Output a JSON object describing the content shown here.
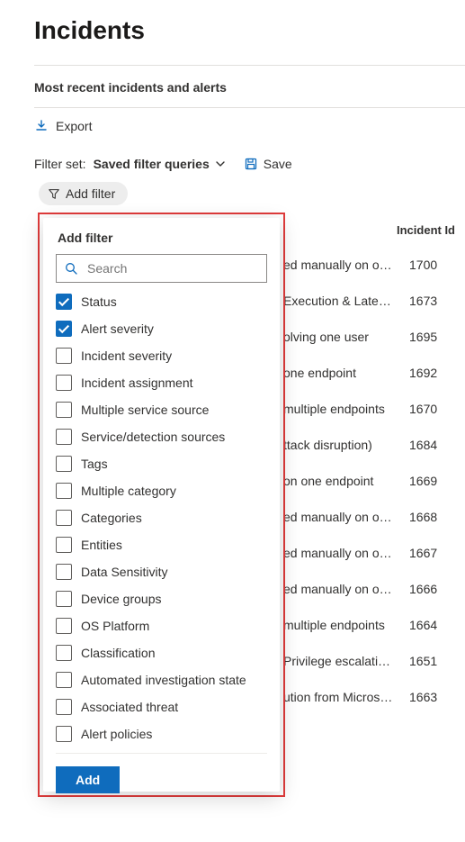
{
  "header": {
    "title": "Incidents",
    "subtitle": "Most recent incidents and alerts"
  },
  "toolbar": {
    "export_label": "Export"
  },
  "filterset": {
    "label": "Filter set:",
    "value": "Saved filter queries",
    "save_label": "Save"
  },
  "add_filter_chip": "Add filter",
  "table": {
    "incident_id_header": "Incident Id",
    "rows": [
      {
        "name": "ed manually on o…",
        "id": "1700"
      },
      {
        "name": "Execution & Late…",
        "id": "1673"
      },
      {
        "name": "olving one user",
        "id": "1695"
      },
      {
        "name": "one endpoint",
        "id": "1692"
      },
      {
        "name": "multiple endpoints",
        "id": "1670"
      },
      {
        "name": "ttack disruption)",
        "id": "1684"
      },
      {
        "name": "on one endpoint",
        "id": "1669"
      },
      {
        "name": "ed manually on o…",
        "id": "1668"
      },
      {
        "name": "ed manually on o…",
        "id": "1667"
      },
      {
        "name": "ed manually on o…",
        "id": "1666"
      },
      {
        "name": "multiple endpoints",
        "id": "1664"
      },
      {
        "name": "Privilege escalati…",
        "id": "1651"
      },
      {
        "name": "ution from Micros…",
        "id": "1663"
      }
    ]
  },
  "filter_popover": {
    "title": "Add filter",
    "search_placeholder": "Search",
    "add_button": "Add",
    "options": [
      {
        "label": "Status",
        "checked": true
      },
      {
        "label": "Alert severity",
        "checked": true
      },
      {
        "label": "Incident severity",
        "checked": false
      },
      {
        "label": "Incident assignment",
        "checked": false
      },
      {
        "label": "Multiple service source",
        "checked": false
      },
      {
        "label": "Service/detection sources",
        "checked": false
      },
      {
        "label": "Tags",
        "checked": false
      },
      {
        "label": "Multiple category",
        "checked": false
      },
      {
        "label": "Categories",
        "checked": false
      },
      {
        "label": "Entities",
        "checked": false
      },
      {
        "label": "Data Sensitivity",
        "checked": false
      },
      {
        "label": "Device groups",
        "checked": false
      },
      {
        "label": "OS Platform",
        "checked": false
      },
      {
        "label": "Classification",
        "checked": false
      },
      {
        "label": "Automated investigation state",
        "checked": false
      },
      {
        "label": "Associated threat",
        "checked": false
      },
      {
        "label": "Alert policies",
        "checked": false
      }
    ]
  }
}
